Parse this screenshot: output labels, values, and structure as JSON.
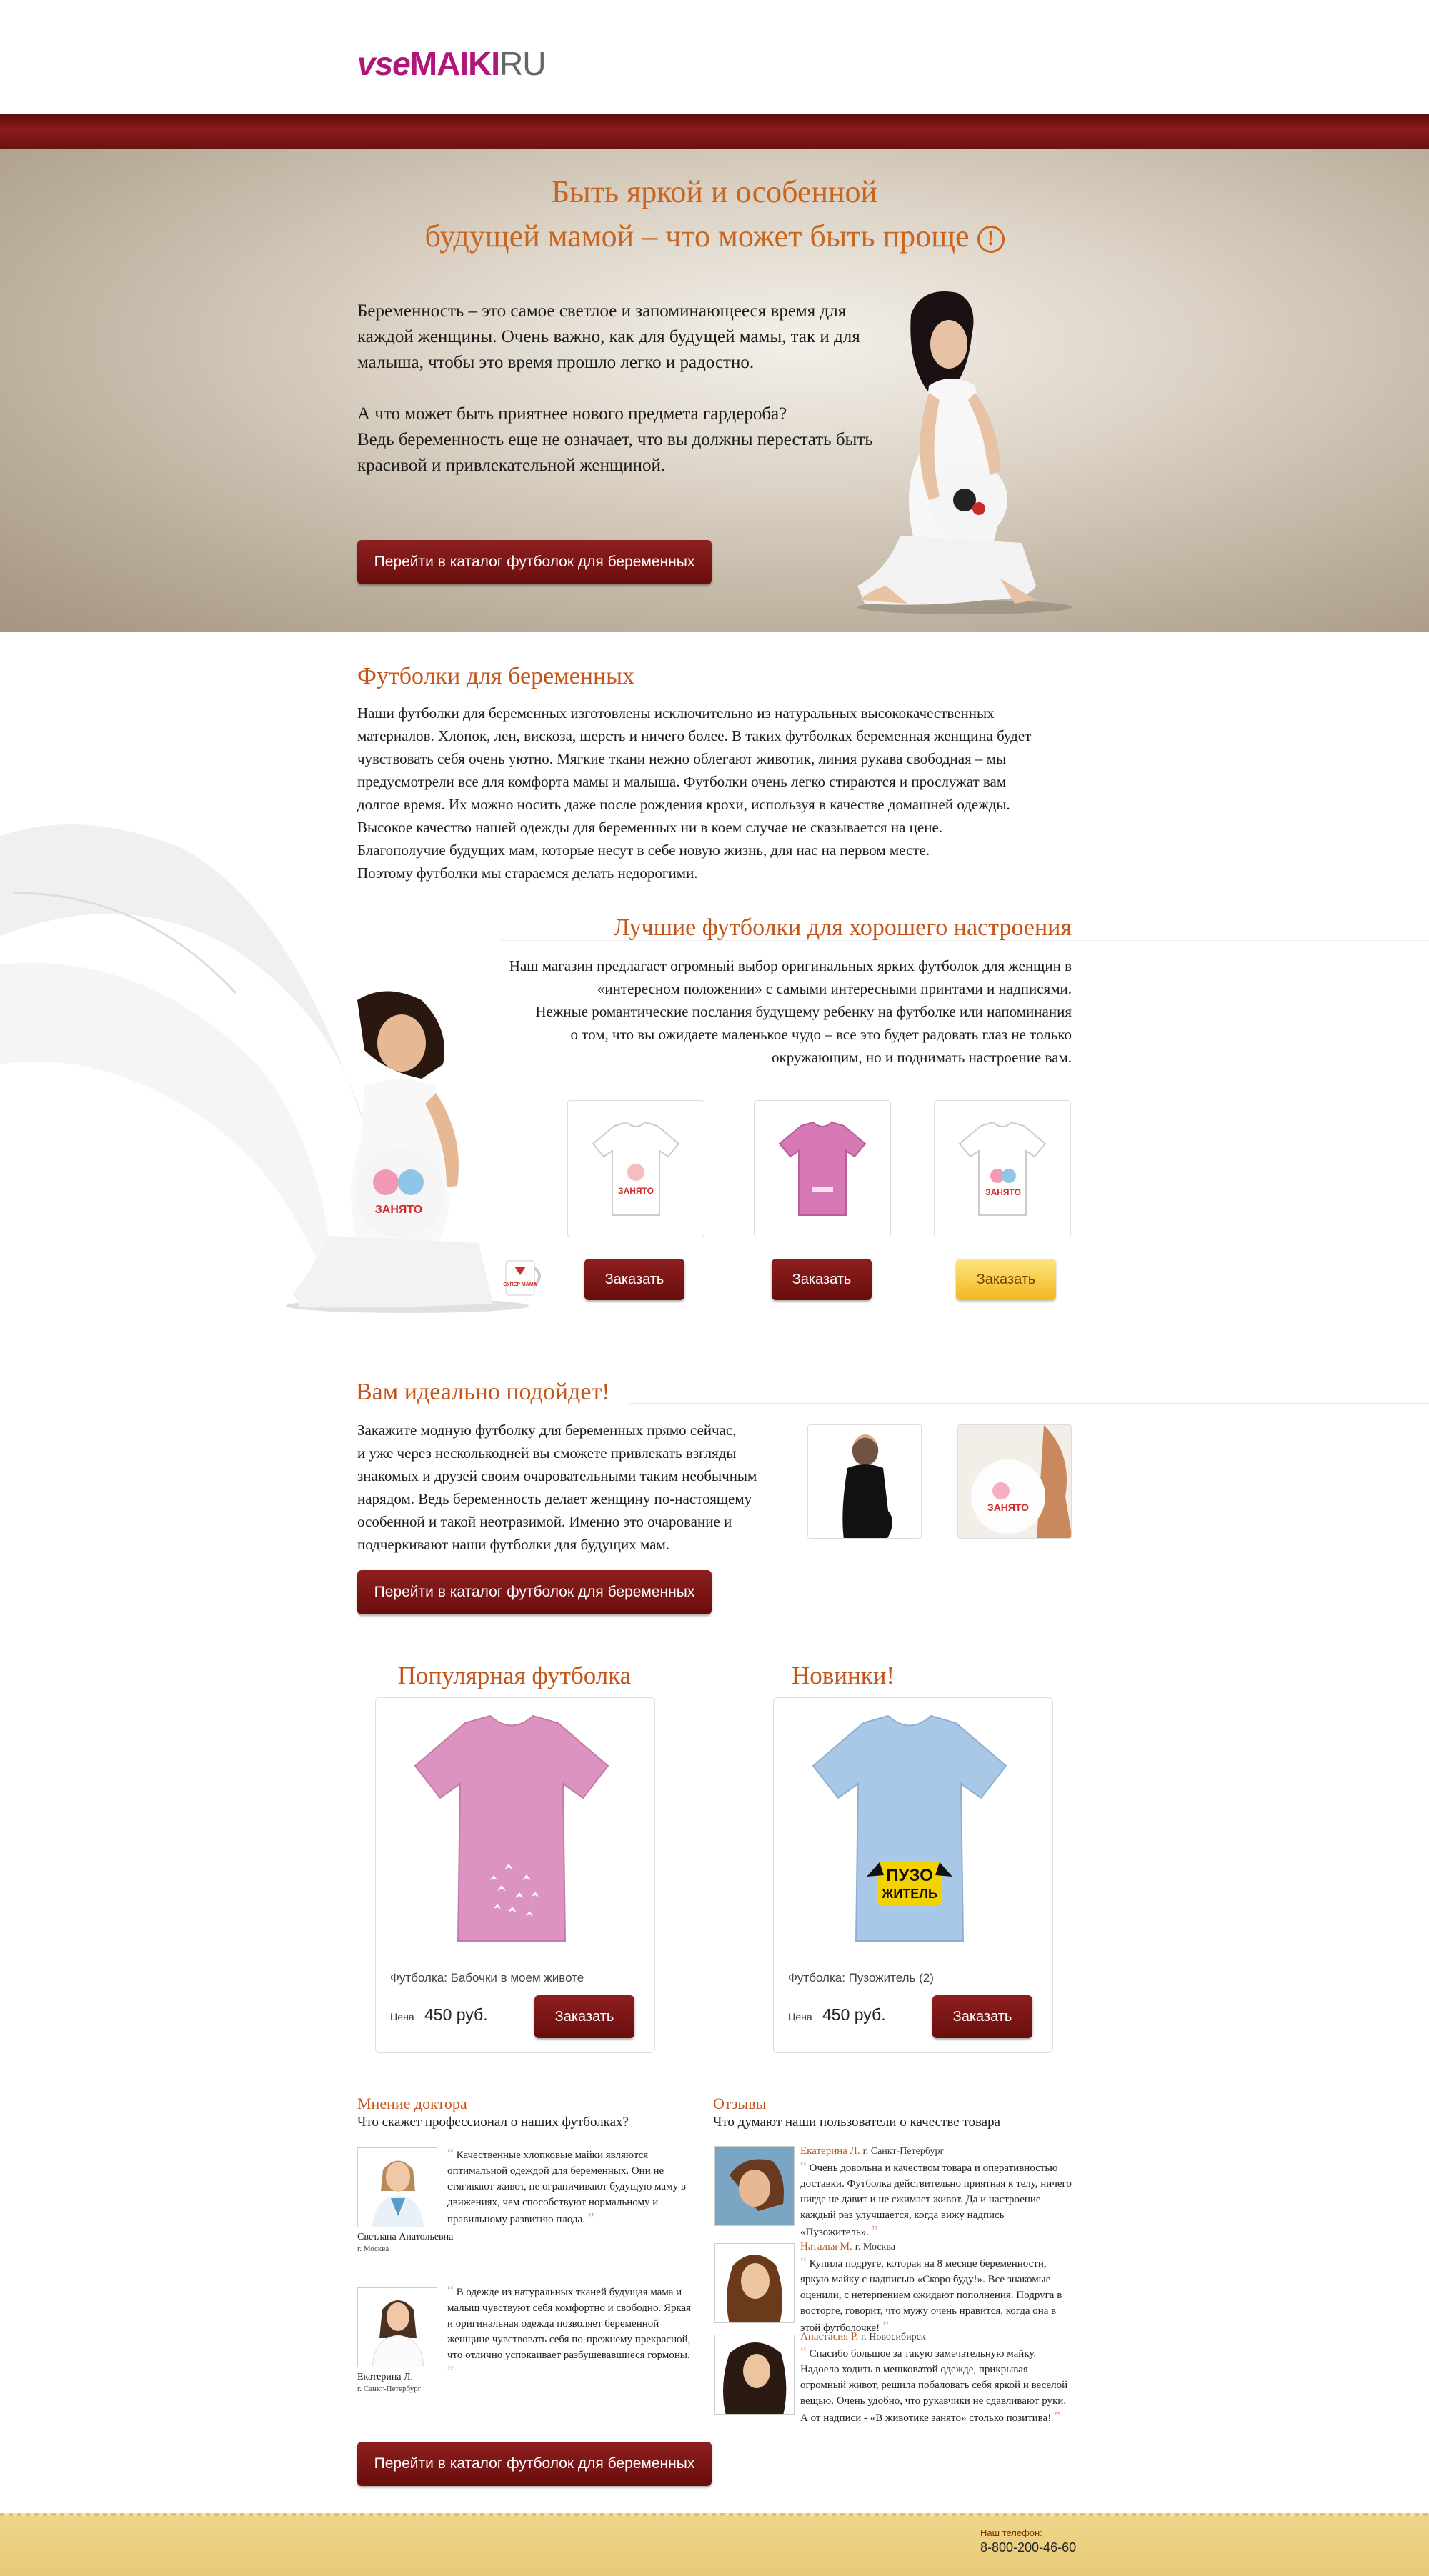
{
  "header": {
    "logo_part1": "vse",
    "logo_part2": "MAIKI",
    "logo_part3": "RU"
  },
  "hero": {
    "title_line1": "Быть яркой и особенной",
    "title_line2": "будущей мамой – что может быть проще",
    "excl": "!",
    "p1_l1": "Беременность – это самое светлое и запоминающееся время для",
    "p1_l2": "каждой женщины. Очень важно, как для будущей мамы, так и для",
    "p1_l3": "малыша, чтобы это время прошло легко и радостно.",
    "p2_l1": "А что может быть приятнее нового предмета гардероба?",
    "p2_l2": "Ведь беременность еще не означает, что вы должны перестать быть",
    "p2_l3": "красивой и привлекательной женщиной.",
    "button": "Перейти в каталог футболок для беременных"
  },
  "section1": {
    "title": "Футболки для беременных",
    "lines": [
      "Наши футболки для беременных изготовлены исключительно из натуральных высококачественных",
      "материалов. Хлопок, лен, вискоза, шерсть и ничего более. В таких футболках беременная женщина будет",
      "чувствовать себя очень уютно. Мягкие ткани нежно облегают животик, линия рукава свободная – мы",
      "предусмотрели все для комфорта мамы и малыша.  Футболки очень легко стираются и прослужат вам",
      "долгое время. Их можно носить даже после рождения крохи, используя в качестве домашней одежды.",
      "Высокое качество нашей одежды для беременных ни в коем случае не сказывается на цене.",
      "Благополучие будущих мам, которые несут в себе новую жизнь, для нас на первом месте.",
      "Поэтому футболки мы стараемся делать недорогими."
    ]
  },
  "section2": {
    "title": "Лучшие футболки для хорошего настроения",
    "lines": [
      "Наш магазин предлагает огромный выбор оригинальных ярких футболок для женщин в",
      "«интересном положении» с самыми интересными принтами и надписями.",
      "Нежные романтические послания будущему ребенку на футболке или напоминания",
      "о том, что вы ожидаете маленькое чудо – все это будет радовать глаз не только",
      "окружающим, но и поднимать настроение вам."
    ],
    "order": "Заказать",
    "mug_text": "СУПЕР МАМА",
    "print1": "ЗАНЯТО",
    "print2": "ЗАНЯТО"
  },
  "section3": {
    "title": "Вам идеально подойдет!",
    "lines": [
      "Закажите модную футболку для беременных прямо сейчас,",
      "и уже через несколькодней вы сможете привлекать взгляды",
      "знакомых и друзей своим очаровательными таким необычным",
      "нарядом. Ведь беременность делает женщину по-настоящему",
      "особенной и такой неотразимой. Именно это очарование и",
      "подчеркивают наши футболки для будущих мам."
    ],
    "button": "Перейти в каталог футболок для беременных"
  },
  "products": [
    {
      "heading": "Популярная футболка",
      "label": "Футболка:",
      "name": "Бабочки в моем животе",
      "price_label": "Цена",
      "price": "450 руб.",
      "button": "Заказать",
      "color": "#de94c0"
    },
    {
      "heading": "Новинки!",
      "label": "Футболка:",
      "name": "Пузожитель (2)",
      "price_label": "Цена",
      "price": "450 руб.",
      "button": "Заказать",
      "color": "#a9c8e8"
    }
  ],
  "doctor": {
    "title": "Мнение доктора",
    "subtitle": "Что скажет профессионал о наших футболках?",
    "items": [
      {
        "text": "Качественные хлопковые майки являются оптимальной одеждой для беременных. Они не стягивают живот, не ограничивают будущую маму в движениях, чем способствуют нормальному и правильному развитию плода.",
        "name": "Светлана Анатольевна",
        "city": "г. Москва"
      },
      {
        "text": "В одежде из натуральных тканей будущая мама и малыш чувствуют себя комфортно и свободно. Яркая и оригинальная одежда позволяет беременной женщине чувствовать себя по-прежнему прекрасной, что отлично успокаивает разбушевавшиеся гормоны.",
        "name": "Екатерина Л.",
        "city": "г. Санкт-Петербург"
      }
    ]
  },
  "reviews": {
    "title": "Отзывы",
    "subtitle": "Что думают наши пользователи о качестве товара",
    "items": [
      {
        "name": "Екатерина Л.",
        "city": "г. Санкт-Петербург",
        "text": "Очень довольна и качеством товара и оперативностью доставки. Футболка действительно приятная к телу, ничего нигде не давит и не сжимает живот. Да и настроение каждый раз улучшается, когда вижу надпись «Пузожитель»."
      },
      {
        "name": "Наталья М.",
        "city": "г. Москва",
        "text": "Купила подруге, которая на 8 месяце беременности, яркую майку с надписью «Скоро буду!». Все знакомые оценили, с нетерпением ожидают пополнения. Подруга в восторге, говорит, что мужу очень нравится, когда она в этой футболочке!"
      },
      {
        "name": "Анастасия Р.",
        "city": "г. Новосибирск",
        "text": "Спасибо большое за такую замечательную майку. Надоело ходить в мешковатой одежде, прикрывая огромный живот, решила побаловать себя яркой и веселой вещью. Очень удобно, что рукавчики не сдавливают руки. А от надписи - «В животике занято» столько позитива!"
      }
    ]
  },
  "bottom_button": "Перейти в каталог футболок для беременных",
  "footer": {
    "phone_label": "Наш телефон:",
    "phone": "8-800-200-46-60"
  }
}
